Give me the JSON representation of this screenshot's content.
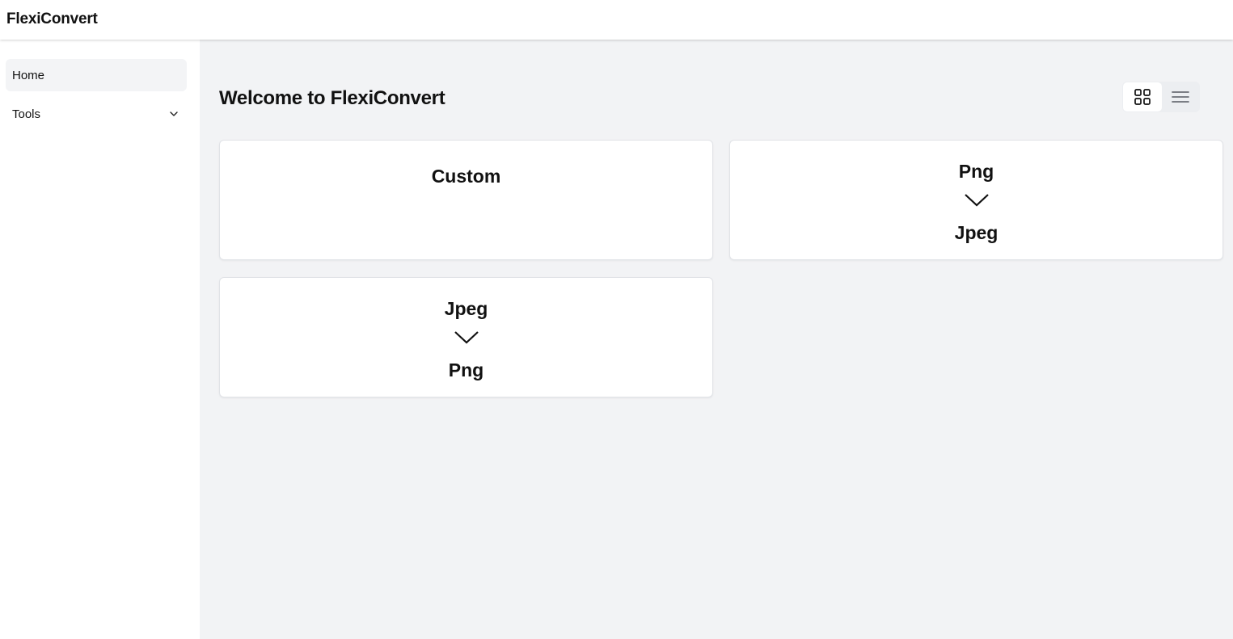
{
  "app": {
    "title": "FlexiConvert"
  },
  "sidebar": {
    "items": [
      {
        "label": "Home",
        "active": true
      },
      {
        "label": "Tools",
        "expandable": true,
        "icon": "chevron-down-icon"
      }
    ]
  },
  "main": {
    "title": "Welcome to FlexiConvert",
    "view_toggle": {
      "options": [
        {
          "icon": "grid-view-icon",
          "active": true
        },
        {
          "icon": "list-view-icon",
          "active": false
        }
      ]
    },
    "cards": [
      {
        "type": "custom",
        "title": "Custom"
      },
      {
        "type": "conversion",
        "from": "Png",
        "to": "Jpeg",
        "icon": "chevron-down-icon"
      },
      {
        "type": "conversion",
        "from": "Jpeg",
        "to": "Png",
        "icon": "chevron-down-icon"
      }
    ]
  },
  "colors": {
    "background": "#f2f3f5",
    "surface": "#ffffff",
    "active_nav": "#f3f4f6",
    "text": "#111111",
    "border": "#e1e3e7"
  }
}
